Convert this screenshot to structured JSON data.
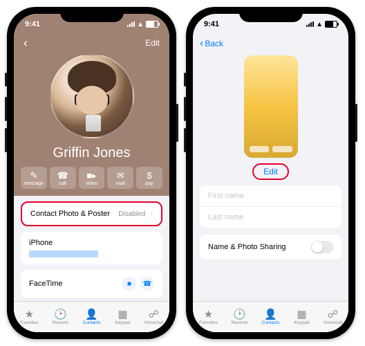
{
  "status": {
    "time": "9:41"
  },
  "left": {
    "edit_label": "Edit",
    "contact_name": "Griffin Jones",
    "actions": {
      "message": "message",
      "call": "call",
      "video": "video",
      "mail": "mail",
      "pay": "pay"
    },
    "photo_poster_label": "Contact Photo & Poster",
    "photo_poster_status": "Disabled",
    "iphone_label": "iPhone",
    "facetime_label": "FaceTime"
  },
  "right": {
    "back_label": "Back",
    "edit_btn": "Edit",
    "first_name_placeholder": "First name",
    "last_name_placeholder": "Last name",
    "sharing_label": "Name & Photo Sharing"
  },
  "tabs": {
    "favorites": "Favorites",
    "recents": "Recents",
    "contacts": "Contacts",
    "keypad": "Keypad",
    "voicemail": "Voicemail"
  }
}
